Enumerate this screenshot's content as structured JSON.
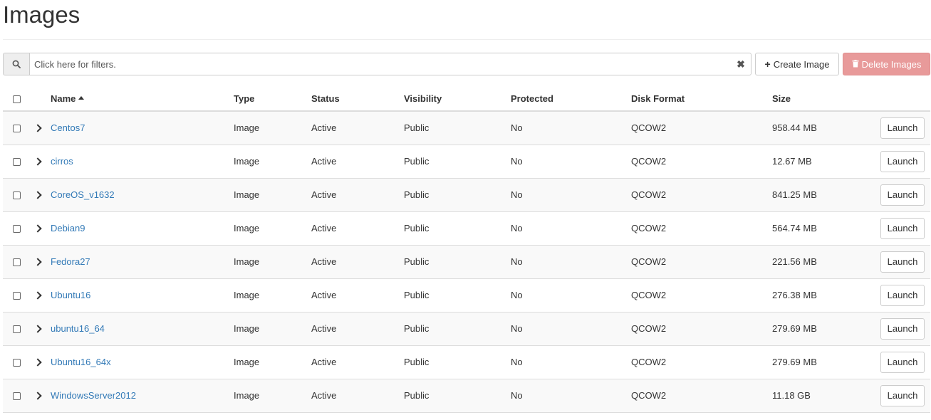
{
  "page": {
    "title": "Images"
  },
  "filter": {
    "placeholder": "Click here for filters.",
    "search_icon": "search-icon",
    "clear_icon": "close-icon"
  },
  "actions": {
    "create_label": "Create Image",
    "create_icon": "plus-icon",
    "delete_label": "Delete Images",
    "delete_icon": "trash-icon",
    "delete_color": "#e89a9a"
  },
  "table": {
    "columns": [
      "Name",
      "Type",
      "Status",
      "Visibility",
      "Protected",
      "Disk Format",
      "Size"
    ],
    "sorted_column": "Name",
    "sort_direction": "ascending",
    "row_action_label": "Launch",
    "link_color": "#337ab7",
    "rows": [
      {
        "name": "Centos7",
        "type": "Image",
        "status": "Active",
        "visibility": "Public",
        "protected": "No",
        "disk_format": "QCOW2",
        "size": "958.44 MB"
      },
      {
        "name": "cirros",
        "type": "Image",
        "status": "Active",
        "visibility": "Public",
        "protected": "No",
        "disk_format": "QCOW2",
        "size": "12.67 MB"
      },
      {
        "name": "CoreOS_v1632",
        "type": "Image",
        "status": "Active",
        "visibility": "Public",
        "protected": "No",
        "disk_format": "QCOW2",
        "size": "841.25 MB"
      },
      {
        "name": "Debian9",
        "type": "Image",
        "status": "Active",
        "visibility": "Public",
        "protected": "No",
        "disk_format": "QCOW2",
        "size": "564.74 MB"
      },
      {
        "name": "Fedora27",
        "type": "Image",
        "status": "Active",
        "visibility": "Public",
        "protected": "No",
        "disk_format": "QCOW2",
        "size": "221.56 MB"
      },
      {
        "name": "Ubuntu16",
        "type": "Image",
        "status": "Active",
        "visibility": "Public",
        "protected": "No",
        "disk_format": "QCOW2",
        "size": "276.38 MB"
      },
      {
        "name": "ubuntu16_64",
        "type": "Image",
        "status": "Active",
        "visibility": "Public",
        "protected": "No",
        "disk_format": "QCOW2",
        "size": "279.69 MB"
      },
      {
        "name": "Ubuntu16_64x",
        "type": "Image",
        "status": "Active",
        "visibility": "Public",
        "protected": "No",
        "disk_format": "QCOW2",
        "size": "279.69 MB"
      },
      {
        "name": "WindowsServer2012",
        "type": "Image",
        "status": "Active",
        "visibility": "Public",
        "protected": "No",
        "disk_format": "QCOW2",
        "size": "11.18 GB"
      }
    ]
  }
}
